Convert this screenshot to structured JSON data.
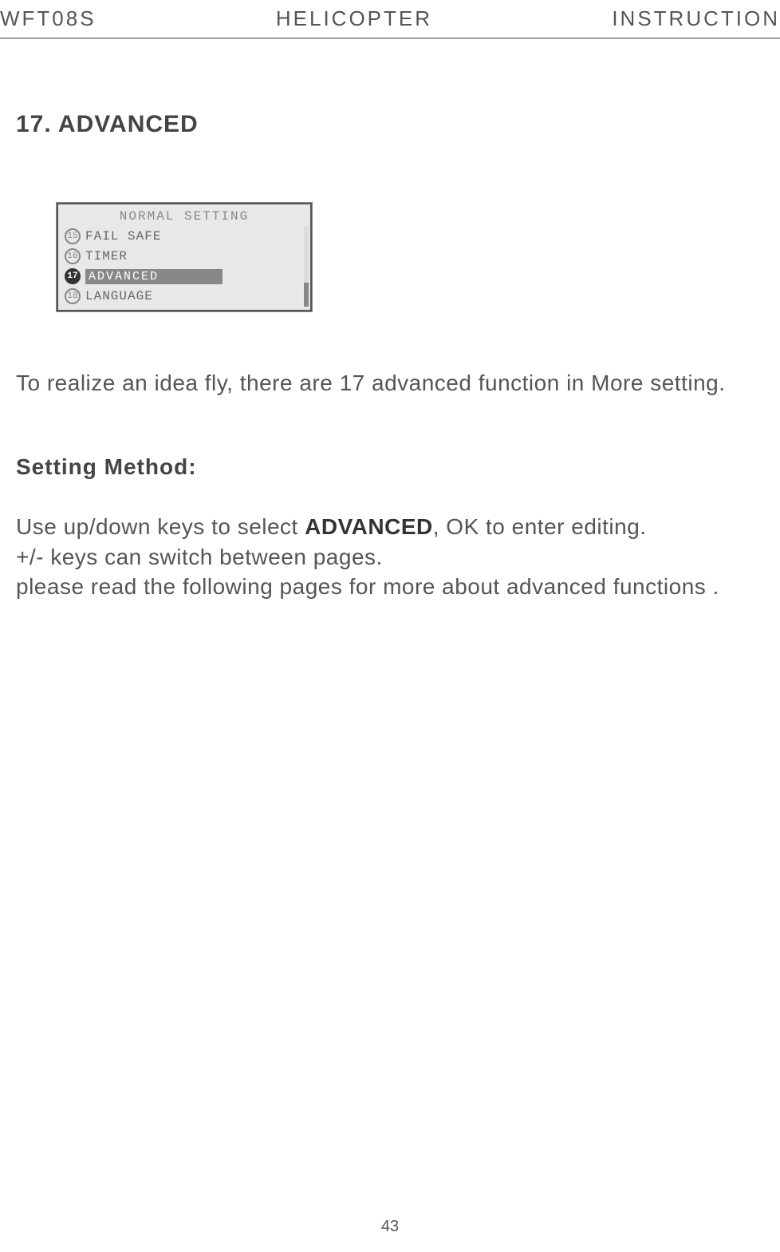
{
  "header": {
    "left": "WFT08S",
    "center": "HELICOPTER",
    "right": "INSTRUCTION"
  },
  "section": {
    "title": "17. ADVANCED"
  },
  "lcd": {
    "title": "NORMAL SETTING",
    "items": [
      {
        "num": "15",
        "label": "FAIL SAFE",
        "selected": false
      },
      {
        "num": "16",
        "label": "TIMER",
        "selected": false
      },
      {
        "num": "17",
        "label": "ADVANCED",
        "selected": true
      },
      {
        "num": "18",
        "label": "LANGUAGE",
        "selected": false
      }
    ]
  },
  "intro": "To realize an idea fly, there are 17 advanced function in More setting.",
  "subsection": {
    "title": "Setting Method:"
  },
  "method": {
    "line1_pre": "Use up/down keys to select ",
    "line1_bold": "ADVANCED",
    "line1_post": ", OK to enter editing.",
    "line2": "+/- keys can switch between pages.",
    "line3": "please read the following pages for more about advanced functions ."
  },
  "page_number": "43"
}
